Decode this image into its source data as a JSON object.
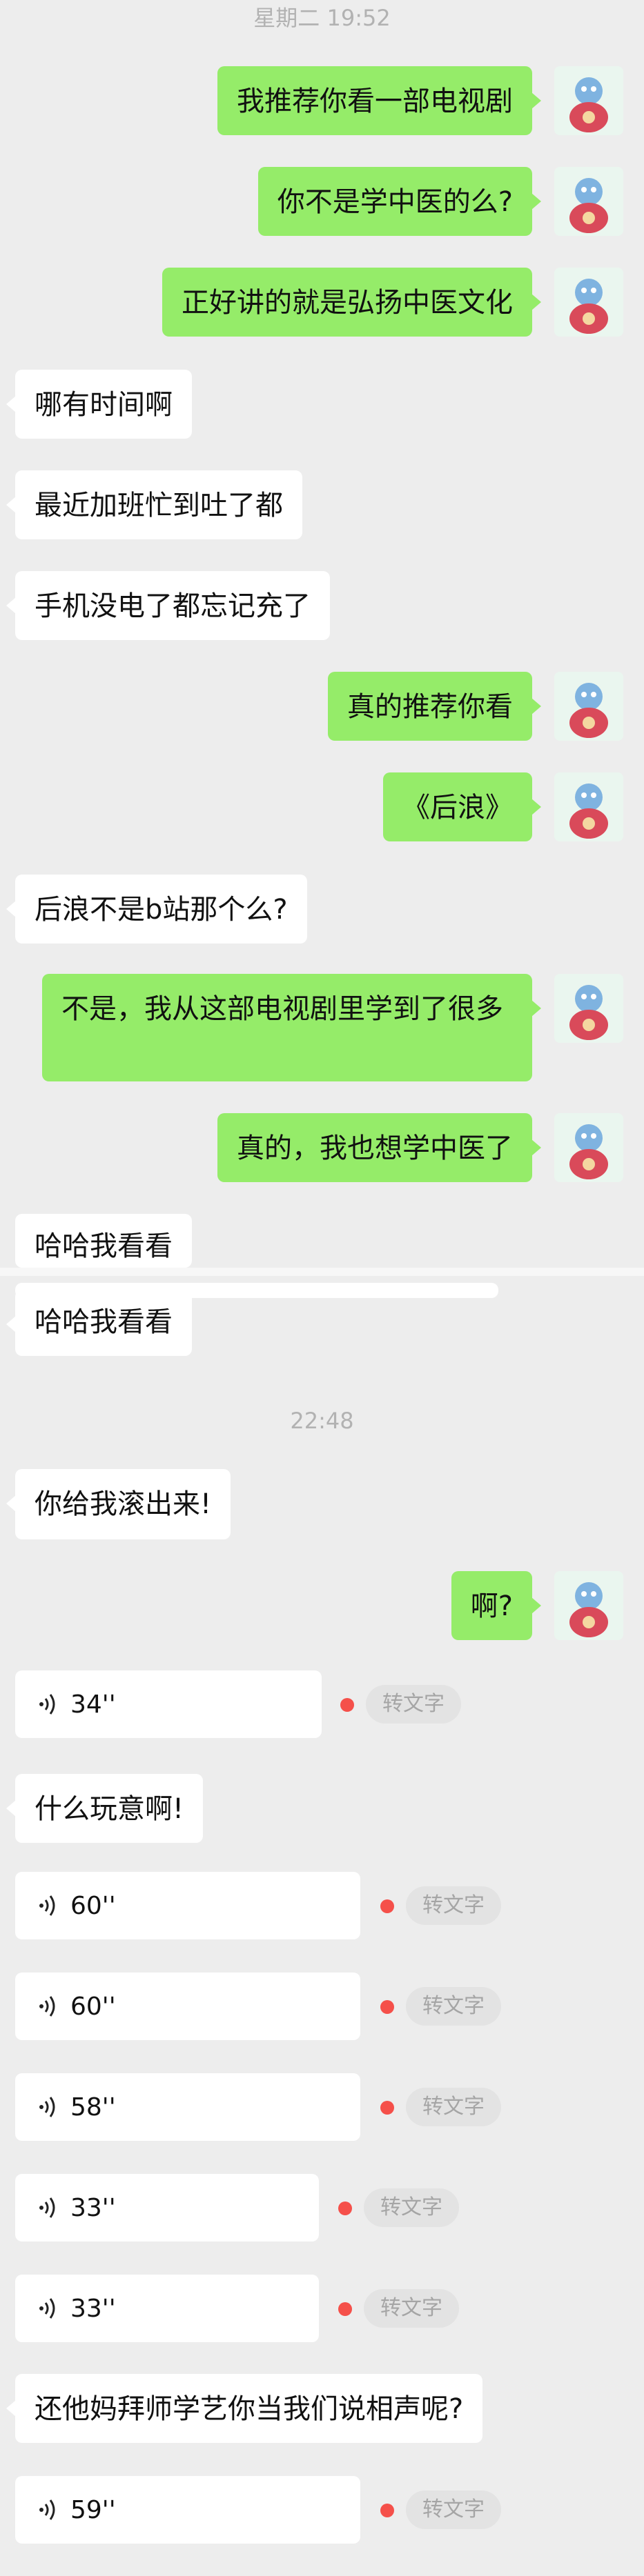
{
  "timestamps": {
    "t1": "星期二 19:52",
    "t2": "22:48"
  },
  "colors": {
    "sent_bubble": "#95ec69",
    "recv_bubble": "#ffffff",
    "background": "#ededed",
    "unread_dot": "#f5504a"
  },
  "messages": {
    "m1": "我推荐你看一部电视剧",
    "m2": "你不是学中医的么?",
    "m3": "正好讲的就是弘扬中医文化",
    "m4": "哪有时间啊",
    "m5": "最近加班忙到吐了都",
    "m6": "手机没电了都忘记充了",
    "m7": "真的推荐你看",
    "m8": "《后浪》",
    "m9": "后浪不是b站那个么?",
    "m10": "不是，我从这部电视剧里学到了很多",
    "m11": "真的，我也想学中医了",
    "m12": "哈哈我看看",
    "m13": "哈哈我看看",
    "m14": "你给我滚出来!",
    "m15": "啊?",
    "m16": "什么玩意啊!",
    "m17": "还他妈拜师学艺你当我们说相声呢?"
  },
  "voices": {
    "v1": "34''",
    "v2": "60''",
    "v3": "60''",
    "v4": "58''",
    "v5": "33''",
    "v6": "33''",
    "v7": "59''"
  },
  "voice_action": "转文字",
  "icons": {
    "avatar": "cartoon-avatar-icon",
    "voice": "voice-wave-icon"
  }
}
